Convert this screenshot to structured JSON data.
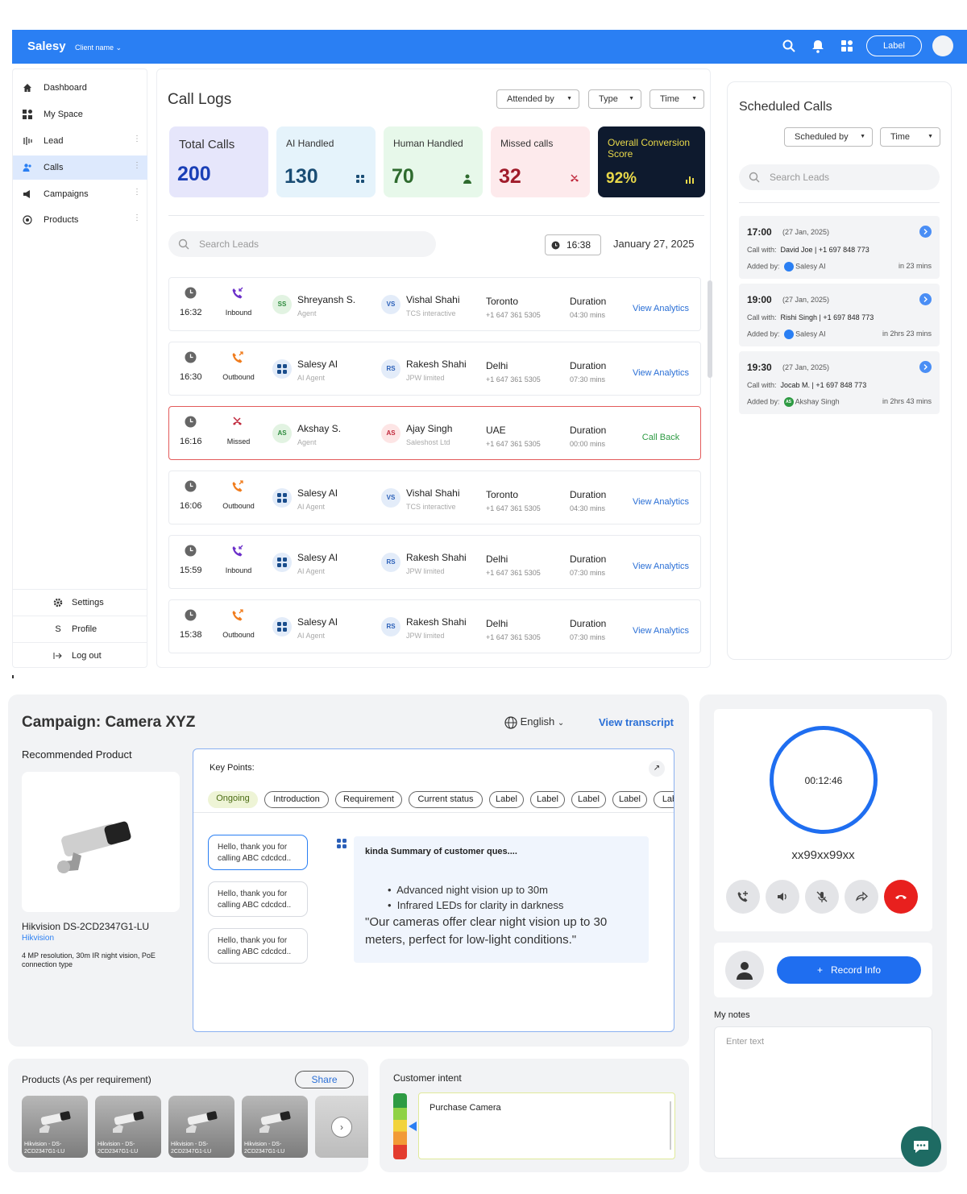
{
  "topbar": {
    "brand": "Salesy",
    "client": "Client name",
    "label_button": "Label"
  },
  "sidebar": {
    "items": [
      {
        "label": "Dashboard"
      },
      {
        "label": "My Space"
      },
      {
        "label": "Lead"
      },
      {
        "label": "Calls"
      },
      {
        "label": "Campaigns"
      },
      {
        "label": "Products"
      }
    ],
    "bottom": [
      {
        "label": "Settings"
      },
      {
        "label": "Profile",
        "glyph": "S"
      },
      {
        "label": "Log out"
      }
    ]
  },
  "call_logs": {
    "title": "Call Logs",
    "filters": [
      "Attended by",
      "Type",
      "Time"
    ],
    "kpis": [
      {
        "title": "Total Calls",
        "value": "200",
        "color": "#e6e6fb"
      },
      {
        "title": "AI Handled",
        "value": "130",
        "color": "#e5f3fb"
      },
      {
        "title": "Human Handled",
        "value": "70",
        "color": "#e7f8ea"
      },
      {
        "title": "Missed calls",
        "value": "32",
        "color": "#fdeaec"
      },
      {
        "title": "Overall Conversion Score",
        "value": "92%",
        "color": "#0e1a2e"
      }
    ],
    "search_placeholder": "Search Leads",
    "time": "16:38",
    "date": "January 27, 2025",
    "duration_label": "Duration",
    "rows": [
      {
        "time": "16:32",
        "direction": "Inbound",
        "agent_initials": "SS",
        "agent": "Shreyansh S.",
        "agent_role": "Agent",
        "lead_initials": "VS",
        "lead": "Vishal Shahi",
        "company": "TCS interactive",
        "city": "Toronto",
        "phone": "+1 647 361 5305",
        "duration": "04:30 mins",
        "action": "View Analytics"
      },
      {
        "time": "16:30",
        "direction": "Outbound",
        "agent_initials": "",
        "agent": "Salesy AI",
        "agent_role": "AI Agent",
        "lead_initials": "RS",
        "lead": "Rakesh Shahi",
        "company": "JPW limited",
        "city": "Delhi",
        "phone": "+1 647 361 5305",
        "duration": "07:30 mins",
        "action": "View Analytics"
      },
      {
        "time": "16:16",
        "direction": "Missed",
        "agent_initials": "AS",
        "agent": "Akshay S.",
        "agent_role": "Agent",
        "lead_initials": "AS",
        "lead": "Ajay Singh",
        "company": "Saleshost Ltd",
        "city": "UAE",
        "phone": "+1 647 361 5305",
        "duration": "00:00 mins",
        "action": "Call Back"
      },
      {
        "time": "16:06",
        "direction": "Outbound",
        "agent_initials": "",
        "agent": "Salesy AI",
        "agent_role": "AI Agent",
        "lead_initials": "VS",
        "lead": "Vishal Shahi",
        "company": "TCS interactive",
        "city": "Toronto",
        "phone": "+1 647 361 5305",
        "duration": "04:30 mins",
        "action": "View Analytics"
      },
      {
        "time": "15:59",
        "direction": "Inbound",
        "agent_initials": "",
        "agent": "Salesy AI",
        "agent_role": "AI Agent",
        "lead_initials": "RS",
        "lead": "Rakesh Shahi",
        "company": "JPW limited",
        "city": "Delhi",
        "phone": "+1 647 361 5305",
        "duration": "07:30 mins",
        "action": "View Analytics"
      },
      {
        "time": "15:38",
        "direction": "Outbound",
        "agent_initials": "",
        "agent": "Salesy AI",
        "agent_role": "AI Agent",
        "lead_initials": "RS",
        "lead": "Rakesh Shahi",
        "company": "JPW limited",
        "city": "Delhi",
        "phone": "+1 647 361 5305",
        "duration": "07:30 mins",
        "action": "View Analytics"
      }
    ]
  },
  "scheduled": {
    "title": "Scheduled Calls",
    "filters": [
      "Scheduled by",
      "Time"
    ],
    "search_placeholder": "Search Leads",
    "call_with_label": "Call with:",
    "added_by_label": "Added by:",
    "cards": [
      {
        "time": "17:00",
        "date": "(27 Jan, 2025)",
        "call_with": "David Joe | +1 697 848 773",
        "added_by": "Salesy AI",
        "in": "in 23 mins"
      },
      {
        "time": "19:00",
        "date": "(27 Jan, 2025)",
        "call_with": "Rishi Singh | +1 697 848 773",
        "added_by": "Salesy AI",
        "in": "in 2hrs 23 mins"
      },
      {
        "time": "19:30",
        "date": "(27 Jan, 2025)",
        "call_with": "Jocab M. | +1 697 848 773",
        "added_by": "Akshay Singh",
        "added_by_initials": "AS",
        "in": "in 2hrs 43 mins"
      }
    ]
  },
  "campaign": {
    "title": "Campaign: Camera XYZ",
    "language": "English",
    "view_transcript": "View transcript",
    "recommended_title": "Recommended Product",
    "product_name": "Hikvision DS-2CD2347G1-LU",
    "product_brand": "Hikvision",
    "product_desc": "4 MP resolution, 30m IR night vision, PoE connection type",
    "key_points_title": "Key Points:",
    "chips": [
      "Ongoing",
      "Introduction",
      "Requirement",
      "Current status",
      "Label",
      "Label",
      "Label",
      "Label",
      "Lab"
    ],
    "messages": [
      "Hello, thank you for calling ABC cdcdcd..",
      "Hello, thank you for calling ABC cdcdcd..",
      "Hello, thank you for calling ABC cdcdcd.."
    ],
    "summary_title": "kinda Summary of customer ques....",
    "bullets": [
      "Advanced night vision up to 30m",
      "Infrared LEDs for clarity in darkness"
    ],
    "quote": "\"Our cameras offer clear night vision up to 30 meters, perfect for low-light conditions.\""
  },
  "products": {
    "title": "Products (As per requirement)",
    "share": "Share",
    "thumbs": [
      "Hikvision - DS-2CD2347G1-LU",
      "Hikvision - DS-2CD2347G1-LU",
      "Hikvision - DS-2CD2347G1-LU",
      "Hikvision - DS-2CD2347G1-LU"
    ]
  },
  "intent": {
    "title": "Customer intent",
    "value": "Purchase Camera"
  },
  "call": {
    "timer": "00:12:46",
    "number": "xx99xx99xx",
    "record_button": "+   Record Info"
  },
  "notes": {
    "title": "My notes",
    "placeholder": "Enter text"
  }
}
